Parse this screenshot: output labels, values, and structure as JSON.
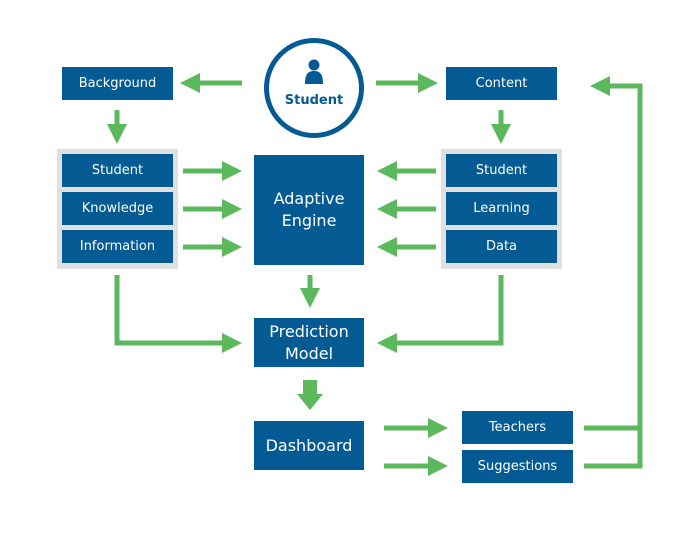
{
  "diagram": {
    "center": {
      "label": "Student",
      "icon": "person-icon"
    },
    "left_top": {
      "label": "Background"
    },
    "right_top": {
      "label": "Content"
    },
    "left_group": {
      "items": [
        "Student",
        "Knowledge",
        "Information"
      ]
    },
    "right_group": {
      "items": [
        "Student",
        "Learning",
        "Data"
      ]
    },
    "engine": {
      "line1": "Adaptive",
      "line2": "Engine"
    },
    "prediction": {
      "line1": "Prediction",
      "line2": "Model"
    },
    "dashboard": {
      "label": "Dashboard"
    },
    "outputs": {
      "items": [
        "Teachers",
        "Suggestions"
      ]
    },
    "colors": {
      "box": "#045b94",
      "arrow": "#5cb85c",
      "group_bg": "#e0e0e0"
    }
  }
}
